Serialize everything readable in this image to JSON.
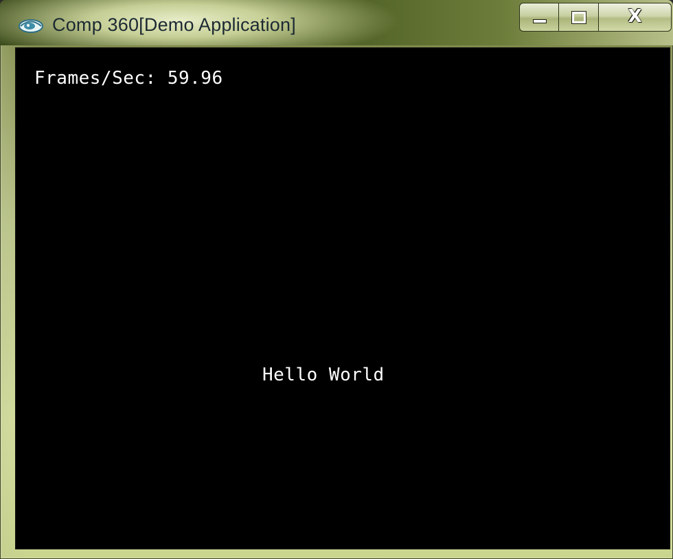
{
  "window": {
    "title": "Comp 360[Demo Application]",
    "app_icon": "eye-logo-icon",
    "controls": {
      "minimize_icon": "minimize-icon",
      "maximize_icon": "maximize-icon",
      "close_label": "X"
    }
  },
  "canvas": {
    "background": "#000000",
    "text_color": "#ffffff",
    "fps_text": "Frames/Sec: 59.96",
    "center_text": "Hello World"
  }
}
